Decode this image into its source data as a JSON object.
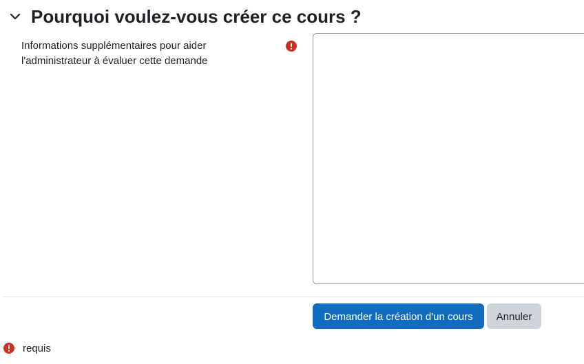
{
  "section": {
    "title": "Pourquoi voulez-vous créer ce cours ?",
    "toggle_icon": "chevron-down-icon"
  },
  "field": {
    "label_line1": "Informations supplémentaires pour aider",
    "label_line2": "l'administrateur à évaluer cette demande",
    "required_icon": "exclamation-circle-icon",
    "value": ""
  },
  "actions": {
    "submit_label": "Demander la création d'un cours",
    "cancel_label": "Annuler"
  },
  "legend": {
    "required_label": "requis",
    "required_icon": "exclamation-circle-icon"
  },
  "colors": {
    "primary": "#0f6cbf",
    "secondary": "#ced4da",
    "required": "#ca3120",
    "text": "#1d2125"
  }
}
